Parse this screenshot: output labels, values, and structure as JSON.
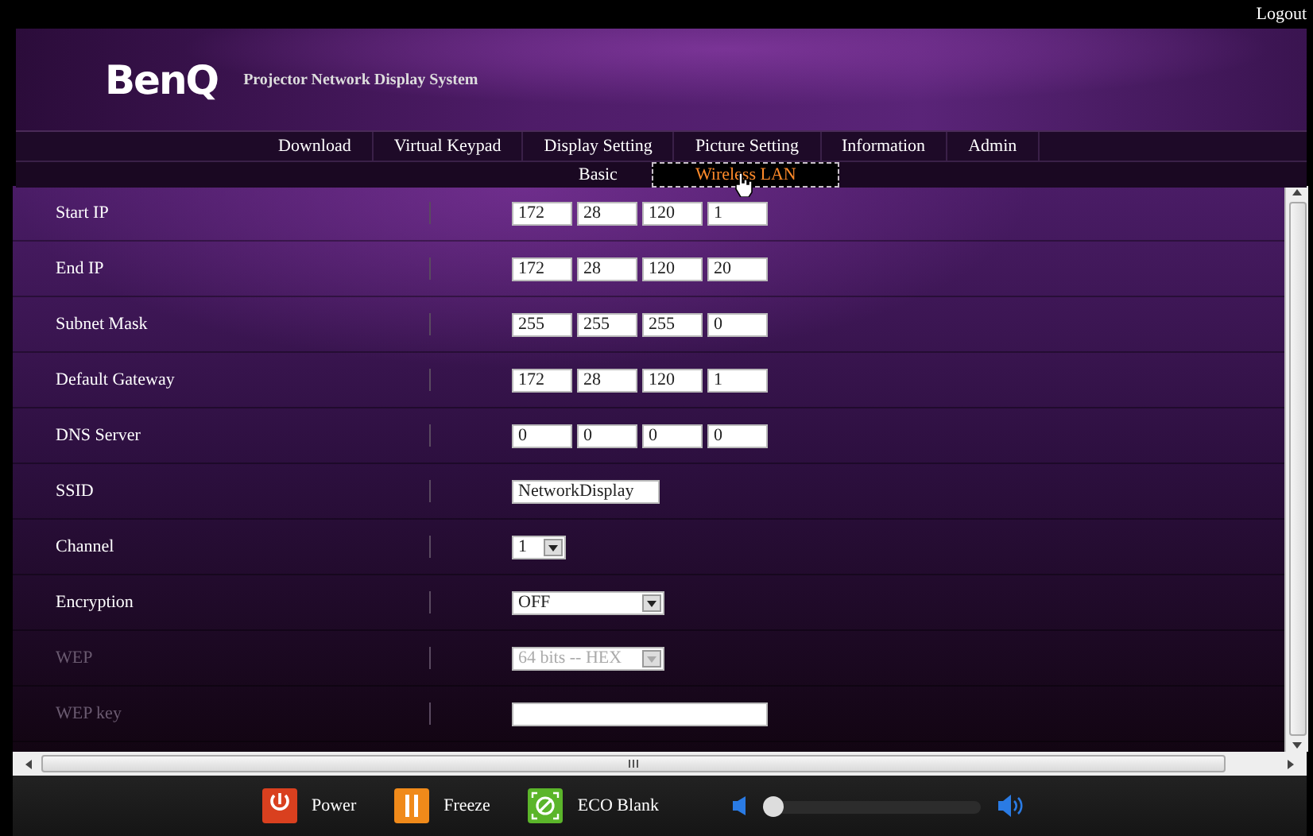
{
  "logout": "Logout",
  "brand": {
    "logo": "BenQ",
    "subtitle": "Projector Network Display System"
  },
  "nav": [
    {
      "label": "Download"
    },
    {
      "label": "Virtual Keypad"
    },
    {
      "label": "Display Setting"
    },
    {
      "label": "Picture Setting"
    },
    {
      "label": "Information"
    },
    {
      "label": "Admin"
    }
  ],
  "subnav": [
    {
      "label": "Basic",
      "selected": false
    },
    {
      "label": "Wireless LAN",
      "selected": true
    }
  ],
  "fields": [
    {
      "label": "Start IP",
      "kind": "ip",
      "disabled": false,
      "octets": [
        "172",
        "28",
        "120",
        "1"
      ]
    },
    {
      "label": "End IP",
      "kind": "ip",
      "disabled": false,
      "octets": [
        "172",
        "28",
        "120",
        "20"
      ]
    },
    {
      "label": "Subnet Mask",
      "kind": "ip",
      "disabled": false,
      "octets": [
        "255",
        "255",
        "255",
        "0"
      ]
    },
    {
      "label": "Default Gateway",
      "kind": "ip",
      "disabled": false,
      "octets": [
        "172",
        "28",
        "120",
        "1"
      ]
    },
    {
      "label": "DNS Server",
      "kind": "ip",
      "disabled": false,
      "octets": [
        "0",
        "0",
        "0",
        "0"
      ]
    },
    {
      "label": "SSID",
      "kind": "text",
      "disabled": false,
      "value": "NetworkDisplay"
    },
    {
      "label": "Channel",
      "kind": "select",
      "disabled": false,
      "value": "1"
    },
    {
      "label": "Encryption",
      "kind": "select",
      "disabled": false,
      "value": "OFF"
    },
    {
      "label": "WEP",
      "kind": "select",
      "disabled": true,
      "value": "64 bits -- HEX"
    },
    {
      "label": "WEP key",
      "kind": "text",
      "disabled": true
    }
  ],
  "controls": [
    {
      "kind": "power",
      "label": "Power"
    },
    {
      "kind": "freeze",
      "label": "Freeze"
    },
    {
      "kind": "eco",
      "label": "ECO Blank"
    }
  ],
  "volume": {
    "level": 0.0
  }
}
